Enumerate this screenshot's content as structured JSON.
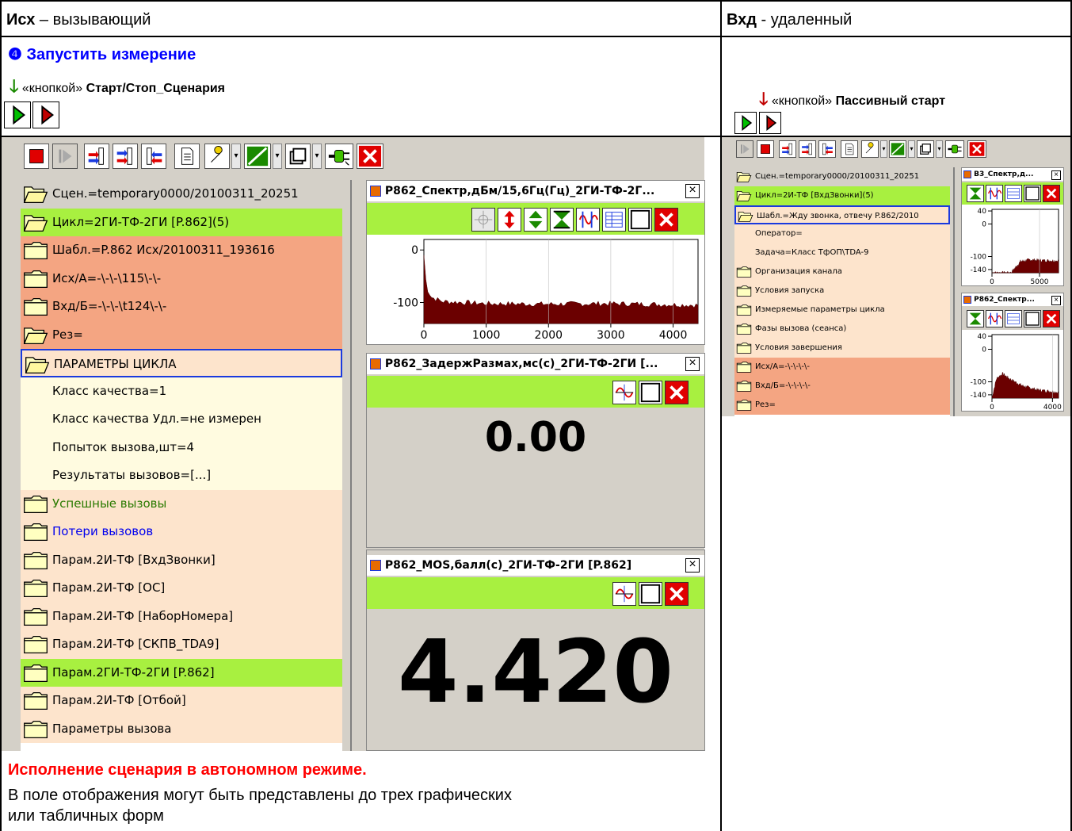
{
  "header": {
    "left_bold": "Исх",
    "left_rest": " – вызывающий",
    "right_bold": "Вхд",
    "right_rest": " - удаленный"
  },
  "left": {
    "step_marker": "❹",
    "step_title": "Запустить измерение",
    "note_prefix": "«кнопкой» ",
    "note_bold": "Старт/Стоп_Сценария"
  },
  "right": {
    "note_prefix": "«кнопкой» ",
    "note_bold": "Пассивный старт"
  },
  "colors": {
    "green_bar": "#a8f040",
    "salmon": "#f4a582",
    "cream": "#fffbe0",
    "peach": "#fde4cc",
    "dark_red": "#6b0000",
    "gray": "#d4d0c8"
  },
  "main_tree": {
    "items": [
      {
        "text": "Сцен.=temporary0000/20100311_20251",
        "icon": "open-folder-icon",
        "bg": "#d4d0c8",
        "color": "#000"
      },
      {
        "text": "Цикл=2ГИ-ТФ-2ГИ [P.862](5)",
        "icon": "open-folder-icon",
        "bg": "#a8f040",
        "color": "#000"
      },
      {
        "text": "Шабл.=P.862 Исх/20100311_193616",
        "icon": "folder-icon",
        "bg": "#f4a582",
        "color": "#000"
      },
      {
        "text": "Исх/А=-\\-\\-\\115\\-\\-",
        "icon": "folder-icon",
        "bg": "#f4a582",
        "color": "#000"
      },
      {
        "text": "Вхд/Б=-\\-\\-\\t124\\-\\-",
        "icon": "folder-icon",
        "bg": "#f4a582",
        "color": "#000"
      },
      {
        "text": "Рез=",
        "icon": "open-folder-icon",
        "bg": "#f4a582",
        "color": "#000"
      },
      {
        "text": "ПАРАМЕТРЫ ЦИКЛА",
        "icon": "open-folder-icon",
        "bg": "#fde4cc",
        "color": "#000",
        "selected": true
      },
      {
        "text": "Класс качества=1",
        "icon": "",
        "bg": "#fffbe0",
        "color": "#000"
      },
      {
        "text": "Класс качества Удл.=не измерен",
        "icon": "",
        "bg": "#fffbe0",
        "color": "#000"
      },
      {
        "text": "Попыток вызова,шт=4",
        "icon": "",
        "bg": "#fffbe0",
        "color": "#000"
      },
      {
        "text": "Результаты вызовов=[...]",
        "icon": "",
        "bg": "#fffbe0",
        "color": "#000"
      },
      {
        "text": "Успешные вызовы",
        "icon": "folder-icon",
        "bg": "#fde4cc",
        "color": "#2a7a00"
      },
      {
        "text": "Потери вызовов",
        "icon": "folder-icon",
        "bg": "#fde4cc",
        "color": "#0000ee"
      },
      {
        "text": "Парам.2И-ТФ [ВхдЗвонки]",
        "icon": "folder-icon",
        "bg": "#fde4cc",
        "color": "#000"
      },
      {
        "text": "Парам.2И-ТФ [ОС]",
        "icon": "folder-icon",
        "bg": "#fde4cc",
        "color": "#000"
      },
      {
        "text": "Парам.2И-ТФ [НаборНомера]",
        "icon": "folder-icon",
        "bg": "#fde4cc",
        "color": "#000"
      },
      {
        "text": "Парам.2И-ТФ [СКПВ_TDA9]",
        "icon": "folder-icon",
        "bg": "#fde4cc",
        "color": "#000"
      },
      {
        "text": "Парам.2ГИ-ТФ-2ГИ [P.862]",
        "icon": "folder-icon",
        "bg": "#a8f040",
        "color": "#000"
      },
      {
        "text": "Парам.2И-ТФ [Отбой]",
        "icon": "folder-icon",
        "bg": "#fde4cc",
        "color": "#000"
      },
      {
        "text": "Параметры вызова",
        "icon": "folder-icon",
        "bg": "#fde4cc",
        "color": "#000"
      }
    ]
  },
  "small_tree": {
    "items": [
      {
        "text": "Сцен.=temporary0000/20100311_20251",
        "icon": "open-folder-icon",
        "bg": "#d4d0c8",
        "color": "#000"
      },
      {
        "text": "Цикл=2И-ТФ [ВхдЗвонки](5)",
        "icon": "open-folder-icon",
        "bg": "#a8f040",
        "color": "#000"
      },
      {
        "text": "Шабл.=Жду звонка, отвечу P.862/2010",
        "icon": "open-folder-icon",
        "bg": "#fde4cc",
        "color": "#000",
        "selected": true
      },
      {
        "text": "Оператор=",
        "icon": "",
        "bg": "#fde4cc",
        "color": "#000"
      },
      {
        "text": "Задача=Класс ТфОП\\TDA-9",
        "icon": "",
        "bg": "#fde4cc",
        "color": "#000"
      },
      {
        "text": "Организация канала",
        "icon": "folder-icon",
        "bg": "#fde4cc",
        "color": "#000"
      },
      {
        "text": "Условия запуска",
        "icon": "folder-icon",
        "bg": "#fde4cc",
        "color": "#000"
      },
      {
        "text": "Измеряемые параметры цикла",
        "icon": "folder-icon",
        "bg": "#fde4cc",
        "color": "#000"
      },
      {
        "text": "Фазы вызова (сеанса)",
        "icon": "folder-icon",
        "bg": "#fde4cc",
        "color": "#000"
      },
      {
        "text": "Условия завершения",
        "icon": "folder-icon",
        "bg": "#fde4cc",
        "color": "#000"
      },
      {
        "text": "Исх/А=-\\-\\-\\-\\-",
        "icon": "folder-icon",
        "bg": "#f4a582",
        "color": "#000"
      },
      {
        "text": "Вхд/Б=-\\-\\-\\-\\-",
        "icon": "folder-icon",
        "bg": "#f4a582",
        "color": "#000"
      },
      {
        "text": "Рез=",
        "icon": "folder-icon",
        "bg": "#f4a582",
        "color": "#000"
      }
    ]
  },
  "windows": {
    "spectrum_title": "P862_Спектр,дБм/15,6Гц(Гц)_2ГИ-ТФ-2Г...",
    "delay_title": "P862_ЗадержРазмах,мс(с)_2ГИ-ТФ-2ГИ [...",
    "delay_value": "0.00",
    "mos_title": "P862_MOS,балл(с)_2ГИ-ТФ-2ГИ [P.862]",
    "mos_value": "4.420",
    "close_glyph": "×",
    "small_spec1_title": "В3_Спектр,д...",
    "small_spec2_title": "P862_Спектр...",
    "dropdown_glyph": "▾"
  },
  "chart_data": [
    {
      "type": "area",
      "title": "",
      "xlabel": "",
      "ylabel": "",
      "xlim": [
        0,
        4400
      ],
      "ylim": [
        -140,
        20
      ],
      "x_ticks": [
        0,
        1000,
        2000,
        3000,
        4000
      ],
      "y_ticks": [
        0,
        -100
      ],
      "x_tick_labels": [
        "0",
        "1000",
        "2000",
        "3000",
        "4000"
      ],
      "y_tick_labels": [
        "0",
        "-100"
      ],
      "series": [
        {
          "x": [
            0,
            40,
            120,
            300,
            1000,
            2000,
            3000,
            4000,
            4400
          ],
          "values": [
            -10,
            -70,
            -90,
            -98,
            -102,
            -103,
            -102,
            -104,
            -105
          ]
        }
      ]
    },
    {
      "type": "area",
      "xlim": [
        0,
        7000
      ],
      "ylim": [
        -150,
        45
      ],
      "x_ticks": [
        0,
        5000
      ],
      "x_tick_labels": [
        "0",
        "5000"
      ],
      "y_ticks": [
        40,
        0,
        -100,
        -140
      ],
      "y_tick_labels": [
        "40",
        "0",
        "-100",
        "-140"
      ],
      "series": [
        {
          "x": [
            0,
            1000,
            2000,
            3000,
            4000,
            5000,
            7000
          ],
          "values": [
            -150,
            -150,
            -150,
            -115,
            -110,
            -112,
            -113
          ]
        }
      ]
    },
    {
      "type": "area",
      "xlim": [
        0,
        4400
      ],
      "ylim": [
        -150,
        45
      ],
      "x_ticks": [
        0,
        4000
      ],
      "x_tick_labels": [
        "0",
        "4000"
      ],
      "y_ticks": [
        40,
        0,
        -100,
        -140
      ],
      "y_tick_labels": [
        "40",
        "0",
        "-100",
        "-140"
      ],
      "series": [
        {
          "x": [
            0,
            300,
            700,
            1200,
            2000,
            3000,
            4000,
            4400
          ],
          "values": [
            -150,
            -90,
            -75,
            -92,
            -112,
            -125,
            -130,
            -133
          ]
        }
      ]
    }
  ],
  "footer": {
    "red_line": "Исполнение сценария в автономном режиме.",
    "desc_line1": "В поле отображения могут быть представлены до трех графических",
    "desc_line2": "или табличных форм"
  }
}
